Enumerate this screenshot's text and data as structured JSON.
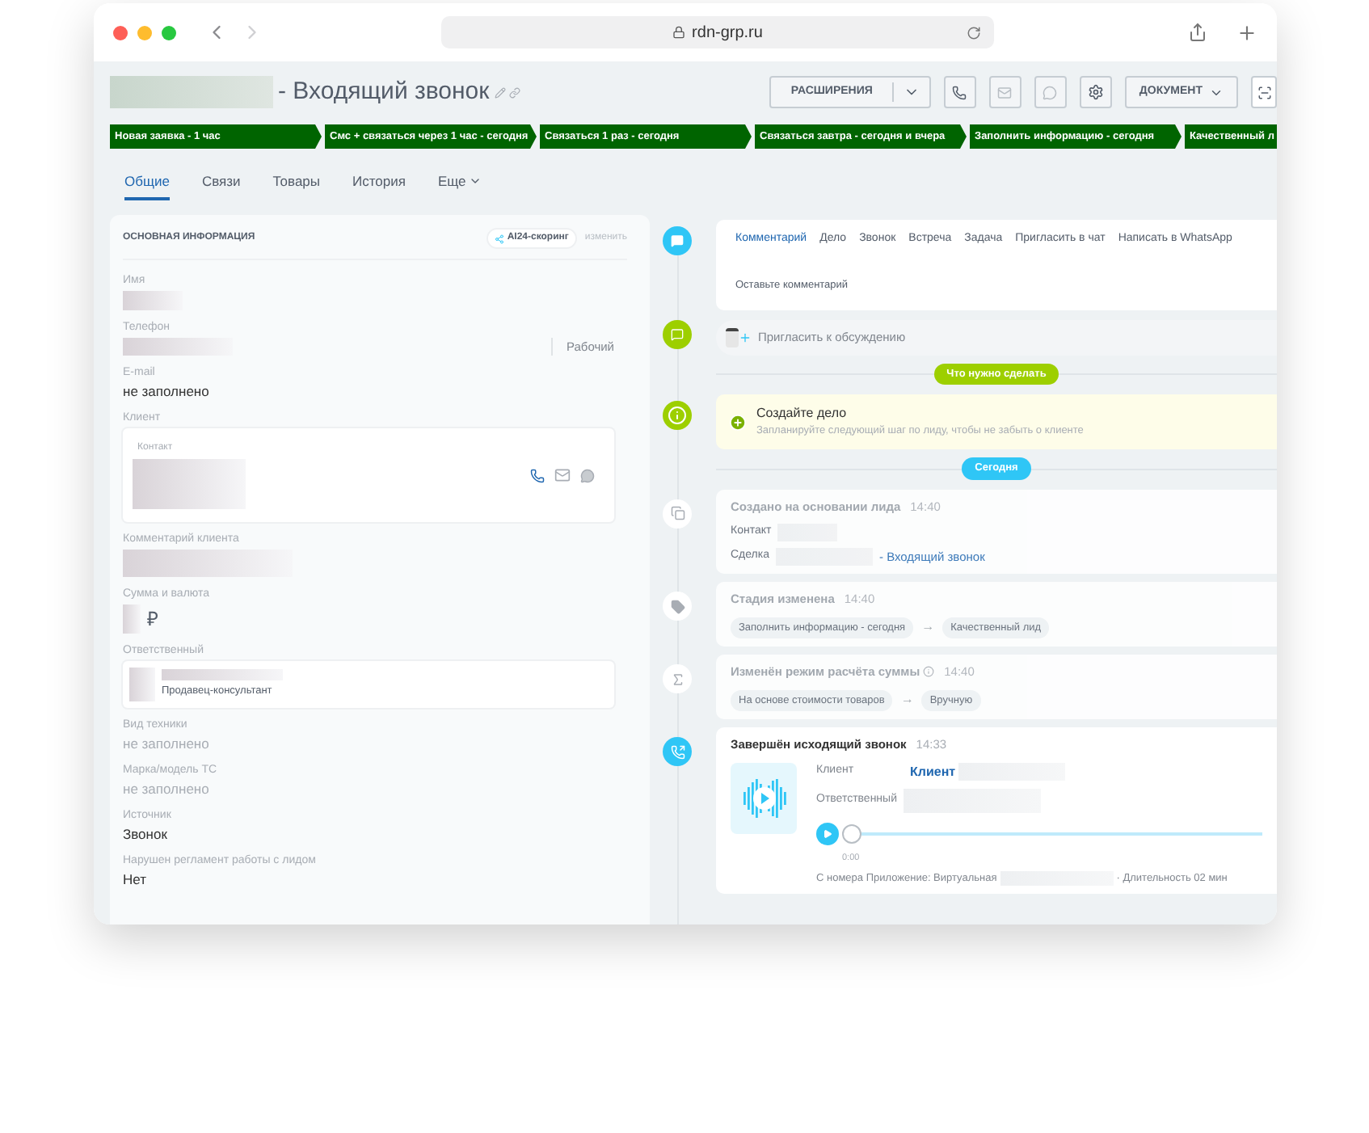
{
  "browser": {
    "url": "rdn-grp.ru"
  },
  "header": {
    "title": "- Входящий звонок",
    "buttons": [
      {
        "kind": "menu",
        "label": "РАСШИРЕНИЯ"
      },
      {
        "kind": "phone"
      },
      {
        "kind": "mail"
      },
      {
        "kind": "chat"
      },
      {
        "kind": "gear"
      },
      {
        "kind": "dropdown",
        "label": "ДОКУМЕНТ"
      },
      {
        "kind": "scan"
      }
    ]
  },
  "stages": [
    "Новая заявка - 1 час",
    "Смс + связаться через 1 час - сегодня",
    "Связаться 1 раз - сегодня",
    "Связаться завтра - сегодня и вчера",
    "Заполнить информацию - сегодня",
    "Качественный л"
  ],
  "tabs": [
    {
      "label": "Общие",
      "selected": true
    },
    {
      "label": "Связи",
      "selected": false
    },
    {
      "label": "Товары",
      "selected": false
    },
    {
      "label": "История",
      "selected": false
    },
    {
      "label": "Еще",
      "selected": false
    }
  ],
  "info": {
    "title": "ОСНОВНАЯ ИНФОРМАЦИЯ",
    "badge": "AI24-скоринг",
    "edit": "изменить",
    "fields": [
      {
        "kind": "redacted",
        "label": "Имя"
      },
      {
        "kind": "phone",
        "label": "Телефон",
        "type": "Рабочий"
      },
      {
        "kind": "text",
        "label": "E-mail",
        "value": "не заполнено"
      },
      {
        "kind": "client",
        "label": "Клиент",
        "caption": "Контакт"
      },
      {
        "kind": "wide",
        "label": "Комментарий клиента"
      },
      {
        "kind": "money",
        "label": "Сумма и валюта",
        "currency": "₽"
      },
      {
        "kind": "person",
        "label": "Ответственный",
        "role": "Продавец-консультант"
      },
      {
        "kind": "empty",
        "label": "Вид техники",
        "value": "не заполнено"
      },
      {
        "kind": "empty",
        "label": "Марка/модель ТС",
        "value": "не заполнено"
      },
      {
        "kind": "text",
        "label": "Источник",
        "value": "Звонок"
      },
      {
        "kind": "text",
        "label": "Нарушен регламент работы с лидом",
        "value": "Нет"
      }
    ]
  },
  "composer": {
    "tabs": [
      {
        "label": "Комментарий",
        "selected": true
      },
      {
        "label": "Дело",
        "selected": false
      },
      {
        "label": "Звонок",
        "selected": false
      },
      {
        "label": "Встреча",
        "selected": false
      },
      {
        "label": "Задача",
        "selected": false
      },
      {
        "label": "Пригласить в чат",
        "selected": false
      },
      {
        "label": "Написать в WhatsApp",
        "selected": false
      }
    ],
    "placeholder": "Оставьте комментарий"
  },
  "invite": "Пригласить к обсуждению",
  "todo_divider": "Что нужно сделать",
  "todo": {
    "title": "Создайте дело",
    "text": "Запланируйте следующий шаг по лиду, чтобы не забыть о клиенте"
  },
  "today_divider": "Сегодня",
  "events": [
    {
      "kind": "created",
      "title": "Создано на основании лида",
      "time": "14:40",
      "contact_label": "Контакт",
      "deal_label": "Сделка",
      "deal_link": "- Входящий звонок"
    },
    {
      "kind": "stage",
      "title": "Стадия изменена",
      "time": "14:40",
      "from": "Заполнить информацию - сегодня",
      "arrow": "→",
      "to": "Качественный лид"
    },
    {
      "kind": "sum",
      "title": "Изменён режим расчёта суммы",
      "time": "14:40",
      "from": "На основе стоимости товаров",
      "arrow": "→",
      "to": "Вручную"
    },
    {
      "kind": "call",
      "title": "Завершён исходящий звонок",
      "time": "14:33",
      "client_label": "Клиент",
      "client": "Клиент",
      "responsible_label": "Ответственный",
      "level": 0,
      "position": "0:00",
      "source": "С номера Приложение: Виртуальная",
      "duration": "· Длительность 02 мин"
    }
  ]
}
